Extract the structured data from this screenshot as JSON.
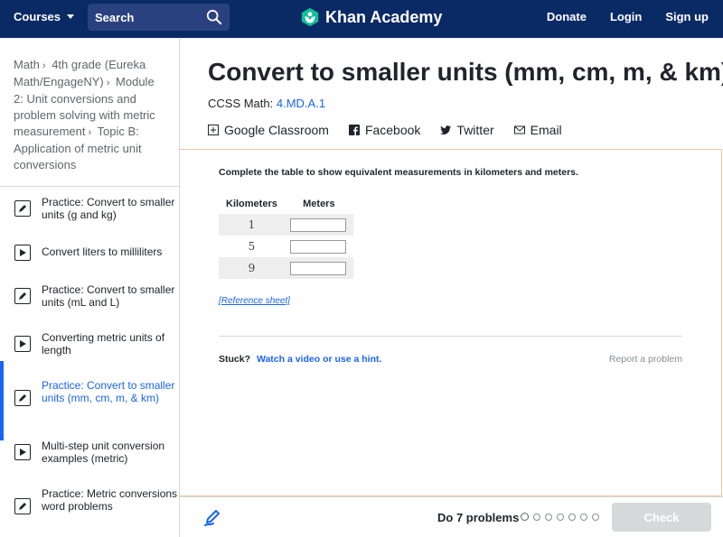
{
  "nav": {
    "courses_label": "Courses",
    "search_placeholder": "Search",
    "logo_text": "Khan Academy",
    "donate": "Donate",
    "login": "Login",
    "signup": "Sign up"
  },
  "breadcrumb": {
    "parts": [
      "Math",
      "4th grade (Eureka Math/EngageNY)",
      "Module 2: Unit conversions and problem solving with metric measurement",
      "Topic B: Application of metric unit conversions"
    ]
  },
  "sidebar": {
    "items": [
      {
        "label": "Practice: Convert to smaller units (g and kg)",
        "icon": "pencil-icon"
      },
      {
        "label": "Convert liters to milliliters",
        "icon": "play-icon"
      },
      {
        "label": "Practice: Convert to smaller units (mL and L)",
        "icon": "pencil-icon"
      },
      {
        "label": "Converting metric units of length",
        "icon": "play-icon"
      },
      {
        "label": "Practice: Convert to smaller units (mm, cm, m, & km)",
        "icon": "pencil-icon",
        "active": true
      },
      {
        "label": "Multi-step unit conversion examples (metric)",
        "icon": "play-icon"
      },
      {
        "label": "Practice: Metric conversions word problems",
        "icon": "pencil-icon"
      }
    ]
  },
  "main": {
    "title": "Convert to smaller units (mm, cm, m, & km)",
    "ccss_prefix": "CCSS Math:",
    "ccss_code": "4.MD.A.1",
    "share": {
      "google": "Google Classroom",
      "facebook": "Facebook",
      "twitter": "Twitter",
      "email": "Email"
    }
  },
  "exercise": {
    "instruction": "Complete the table to show equivalent measurements in kilometers and meters.",
    "headers": [
      "Kilometers",
      "Meters"
    ],
    "rows": [
      {
        "km": "1",
        "m": ""
      },
      {
        "km": "5",
        "m": ""
      },
      {
        "km": "9",
        "m": ""
      }
    ],
    "reference_link": "[Reference sheet]",
    "stuck_label": "Stuck?",
    "stuck_link": "Watch a video or use a hint.",
    "report": "Report a problem"
  },
  "footer": {
    "do_problems": "Do 7 problems",
    "problem_count": 7,
    "current": 1,
    "check_label": "Check"
  },
  "colors": {
    "nav_bg": "#0a2a66",
    "accent": "#1865f2",
    "check_disabled": "#d6d8da",
    "logo_green": "#14bf96"
  }
}
